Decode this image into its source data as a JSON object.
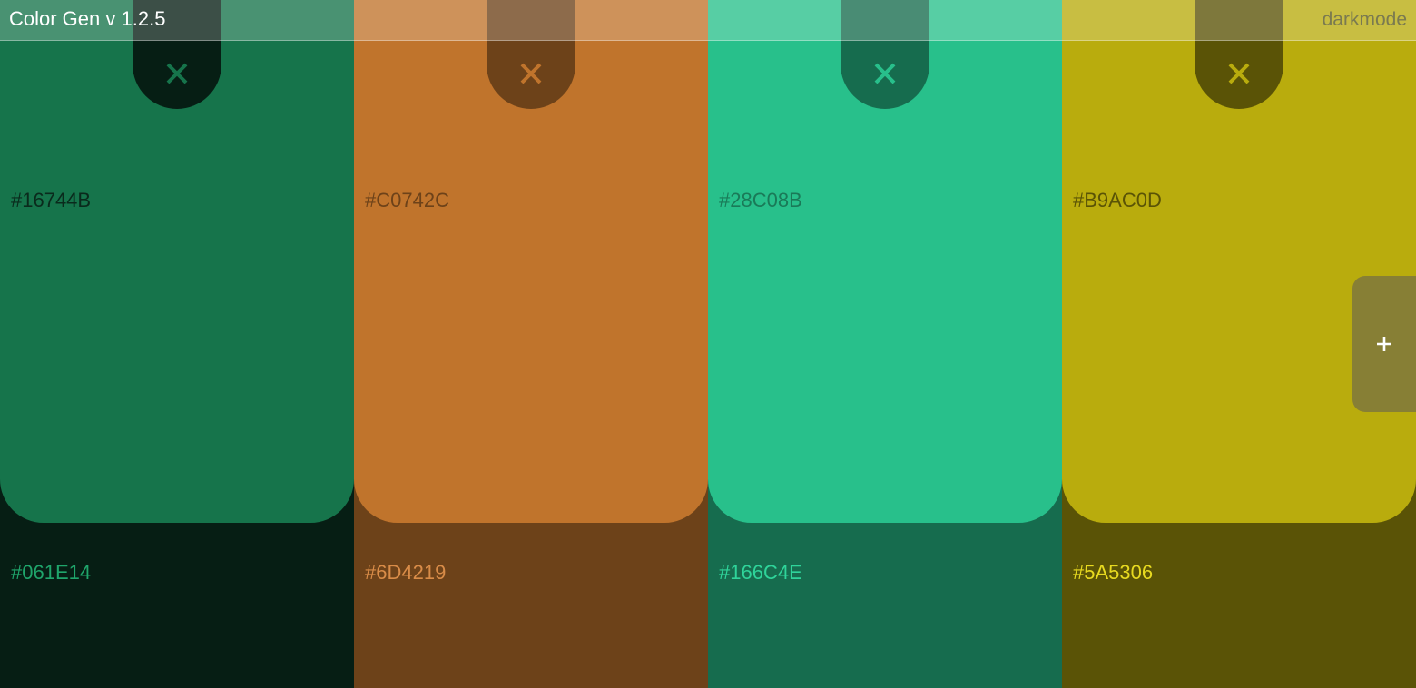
{
  "header": {
    "title": "Color Gen v 1.2.5",
    "darkmode_label": "darkmode",
    "darkmode_color": "#7A7A50"
  },
  "columns": [
    {
      "color": "#16744B",
      "shade": "#061E14",
      "color_label": "#16744B",
      "shade_label": "#061E14",
      "color_text": "#0A2A1C",
      "shade_text": "#1FA56B",
      "tab_bg": "#061E14",
      "icon_color": "#16744B",
      "icon": "close-icon"
    },
    {
      "color": "#C0742C",
      "shade": "#6D4219",
      "color_label": "#C0742C",
      "shade_label": "#6D4219",
      "color_text": "#6D4219",
      "shade_text": "#D98C48",
      "tab_bg": "#6D4219",
      "icon_color": "#C0742C",
      "icon": "close-icon"
    },
    {
      "color": "#28C08B",
      "shade": "#166C4E",
      "color_label": "#28C08B",
      "shade_label": "#166C4E",
      "color_text": "#1A7A58",
      "shade_text": "#2FD49A",
      "tab_bg": "#166C4E",
      "icon_color": "#28C08B",
      "icon": "close-icon"
    },
    {
      "color": "#B9AC0D",
      "shade": "#5A5306",
      "color_label": "#B9AC0D",
      "shade_label": "#5A5306",
      "color_text": "#5A5306",
      "shade_text": "#E8DA20",
      "tab_bg": "#5A5306",
      "icon_color": "#B9AC0D",
      "icon": "close-icon"
    }
  ],
  "add_button": {
    "icon": "plus-icon",
    "background": "#877F35",
    "icon_color": "#FFFFFF"
  }
}
